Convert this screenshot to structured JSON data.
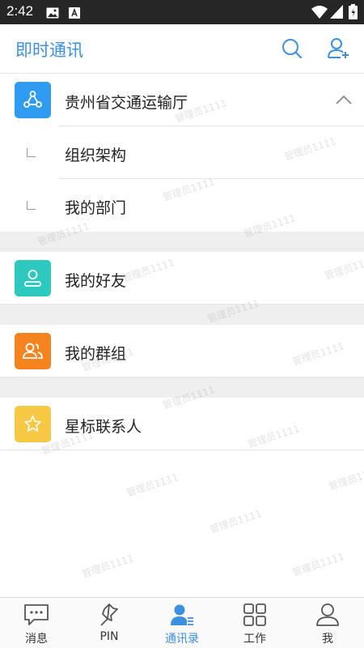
{
  "status_bar": {
    "time": "2:42",
    "icons": [
      "image-icon",
      "font-app-icon",
      "wifi-icon",
      "signal-icon",
      "battery-icon"
    ]
  },
  "header": {
    "title": "即时通讯",
    "actions": [
      "search-icon",
      "add-contact-icon"
    ]
  },
  "sections": {
    "organization": {
      "label": "贵州省交通运输厅",
      "icon": "org-tree-icon",
      "expanded": true,
      "children": [
        {
          "label": "组织架构"
        },
        {
          "label": "我的部门"
        }
      ]
    },
    "friends": {
      "label": "我的好友",
      "icon": "person-icon"
    },
    "groups": {
      "label": "我的群组",
      "icon": "group-icon"
    },
    "starred": {
      "label": "星标联系人",
      "icon": "star-icon"
    }
  },
  "watermark": "管理员1111",
  "bottom_nav": [
    {
      "label": "消息",
      "icon": "message-icon",
      "active": false
    },
    {
      "label": "PIN",
      "icon": "pin-icon",
      "active": false
    },
    {
      "label": "通讯录",
      "icon": "contacts-icon",
      "active": true
    },
    {
      "label": "工作",
      "icon": "grid-icon",
      "active": false
    },
    {
      "label": "我",
      "icon": "profile-icon",
      "active": false
    }
  ],
  "colors": {
    "accent": "#3d8fe0",
    "org_icon": "#2f9cf2",
    "friends_icon": "#2ec9be",
    "groups_icon": "#f5841f",
    "starred_icon": "#f7c843",
    "status_bar": "#262626",
    "section_gap": "#efefef"
  }
}
